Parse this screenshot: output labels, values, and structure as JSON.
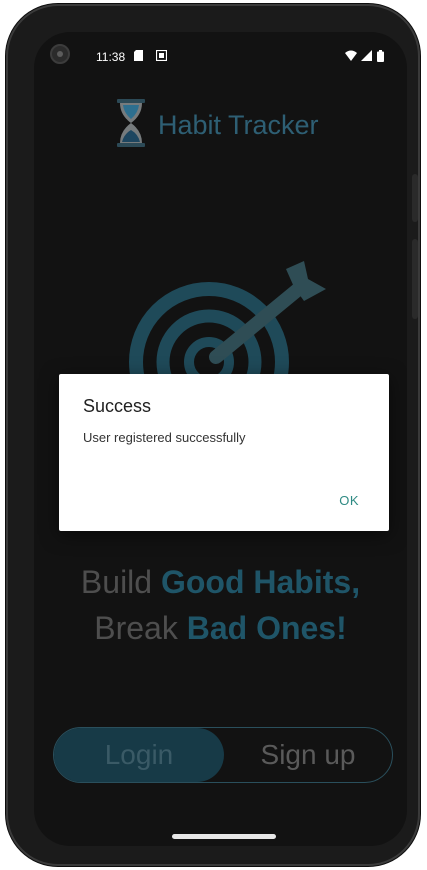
{
  "status_bar": {
    "time": "11:38"
  },
  "app": {
    "title": "Habit Tracker",
    "icon": "hourglass-icon",
    "hero_icon": "target-arrow-icon"
  },
  "tagline": {
    "line1_plain": "Build ",
    "line1_accent": "Good Habits,",
    "line2_plain": "Break ",
    "line2_accent": "Bad Ones!"
  },
  "auth_toggle": {
    "login_label": "Login",
    "signup_label": "Sign up",
    "selected": "Login"
  },
  "dialog": {
    "title": "Success",
    "message": "User registered successfully",
    "ok_label": "OK"
  },
  "colors": {
    "accent": "#2e5f74",
    "dialog_button": "#2e8a83",
    "background": "#121212"
  }
}
